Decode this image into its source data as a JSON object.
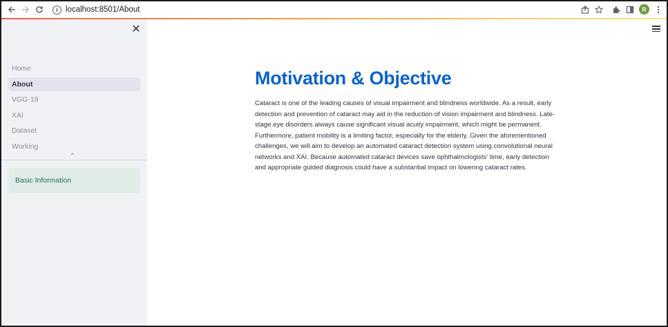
{
  "browser": {
    "url_host": "localhost",
    "url_path": ":8501/About",
    "avatar_letter": "R",
    "icons": [
      "back-arrow-icon",
      "forward-arrow-icon",
      "reload-icon",
      "info-icon",
      "share-icon",
      "star-icon",
      "extensions-icon",
      "side-panel-icon",
      "more-vert-icon"
    ]
  },
  "sidebar": {
    "items": [
      {
        "label": "Home",
        "active": false
      },
      {
        "label": "About",
        "active": true
      },
      {
        "label": "VGG-19",
        "active": false
      },
      {
        "label": "XAI",
        "active": false
      },
      {
        "label": "Dataset",
        "active": false
      },
      {
        "label": "Working",
        "active": false
      }
    ],
    "info_box_label": "Basic Information"
  },
  "main": {
    "title": "Motivation & Objective",
    "paragraph": "Cataract is one of the leading causes of visual impairment and blindness worldwide. As a result, early detection and prevention of cataract may aid in the reduction of vision impairment and blindness. Late-stage eye disorders always cause significant visual acuity impairment, which might be permanent. Furthermore, patient mobility is a limiting factor, especially for the elderly. Given the aforementioned challenges, we will aim to develop an automated cataract detection system using convolutional neural networks and XAI. Because automated cataract devices save ophthalmologists' time, early detection and appropriate guided diagnosis could have a substantial impact on lowering cataract rates."
  },
  "colors": {
    "title": "#0a62c7",
    "sidebar_bg": "#f0f2f6",
    "active_item_bg": "#e1e4ec",
    "info_box_bg": "#dfede6",
    "info_box_text": "#2d6b48"
  }
}
